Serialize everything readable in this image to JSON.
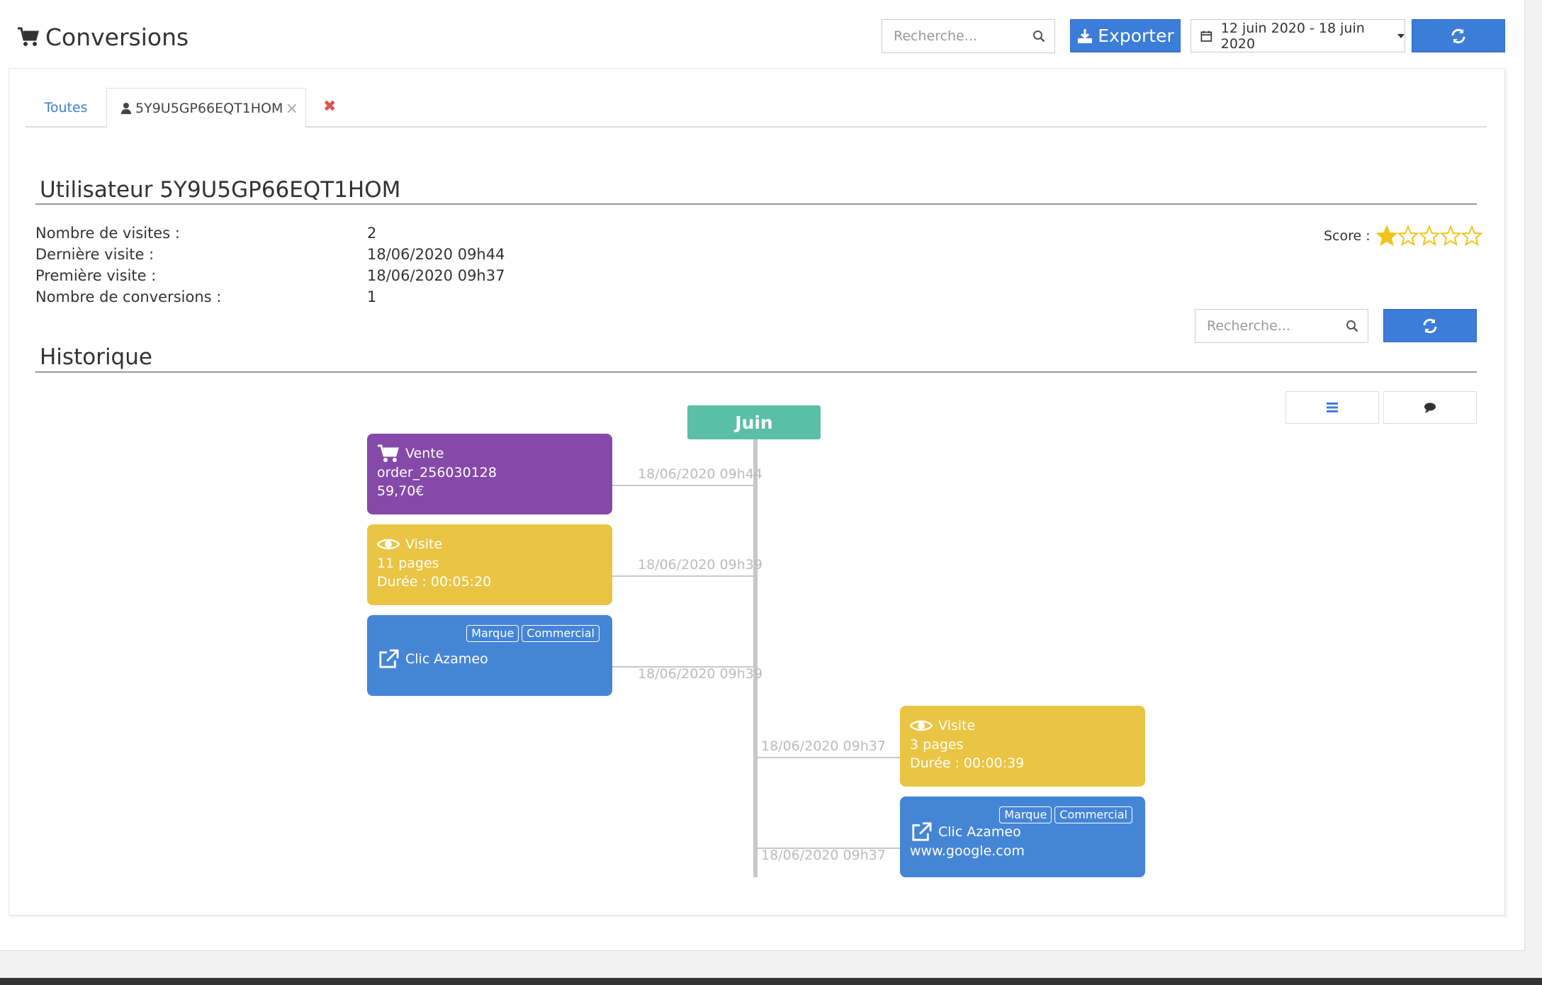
{
  "header": {
    "title": "Conversions",
    "search_placeholder": "Recherche...",
    "export_label": "Exporter",
    "date_range": "12 juin 2020 - 18 juin 2020"
  },
  "tabs": {
    "all_label": "Toutes",
    "user_label": "5Y9U5GP66EQT1HOM",
    "close_symbol": "×",
    "close_all_symbol": "✖"
  },
  "user": {
    "title": "Utilisateur 5Y9U5GP66EQT1HOM",
    "rows": [
      {
        "label": "Nombre de visites :",
        "value": "2"
      },
      {
        "label": "Dernière visite :",
        "value": "18/06/2020 09h44"
      },
      {
        "label": "Première visite :",
        "value": "18/06/2020 09h37"
      },
      {
        "label": "Nombre de conversions :",
        "value": "1"
      }
    ],
    "score_label": "Score :",
    "score_value": 1,
    "score_max": 5
  },
  "history": {
    "title": "Historique",
    "search_placeholder": "Recherche...",
    "month": "Juin",
    "events": [
      {
        "type": "Vente",
        "line2": "order_256030128",
        "line3": "59,70€",
        "timestamp": "18/06/2020 09h44",
        "side": "left",
        "color": "#8549a9",
        "icon": "cart-icon"
      },
      {
        "type": "Visite",
        "line2": "11 pages",
        "line3": "Durée : 00:05:20",
        "timestamp": "18/06/2020 09h39",
        "side": "left",
        "color": "#eac443",
        "icon": "eye-icon"
      },
      {
        "type": "Clic Azameo",
        "line2": "",
        "line3": "",
        "timestamp": "18/06/2020 09h39",
        "side": "left",
        "color": "#4585d6",
        "icon": "external-link-icon",
        "tags": [
          "Marque",
          "Commercial"
        ]
      },
      {
        "type": "Visite",
        "line2": "3 pages",
        "line3": "Durée : 00:00:39",
        "timestamp": "18/06/2020 09h37",
        "side": "right",
        "color": "#eac443",
        "icon": "eye-icon"
      },
      {
        "type": "Clic Azameo",
        "line2": "www.google.com",
        "line3": "",
        "timestamp": "18/06/2020 09h37",
        "side": "right",
        "color": "#4585d6",
        "icon": "external-link-icon",
        "tags": [
          "Marque",
          "Commercial"
        ]
      }
    ]
  }
}
